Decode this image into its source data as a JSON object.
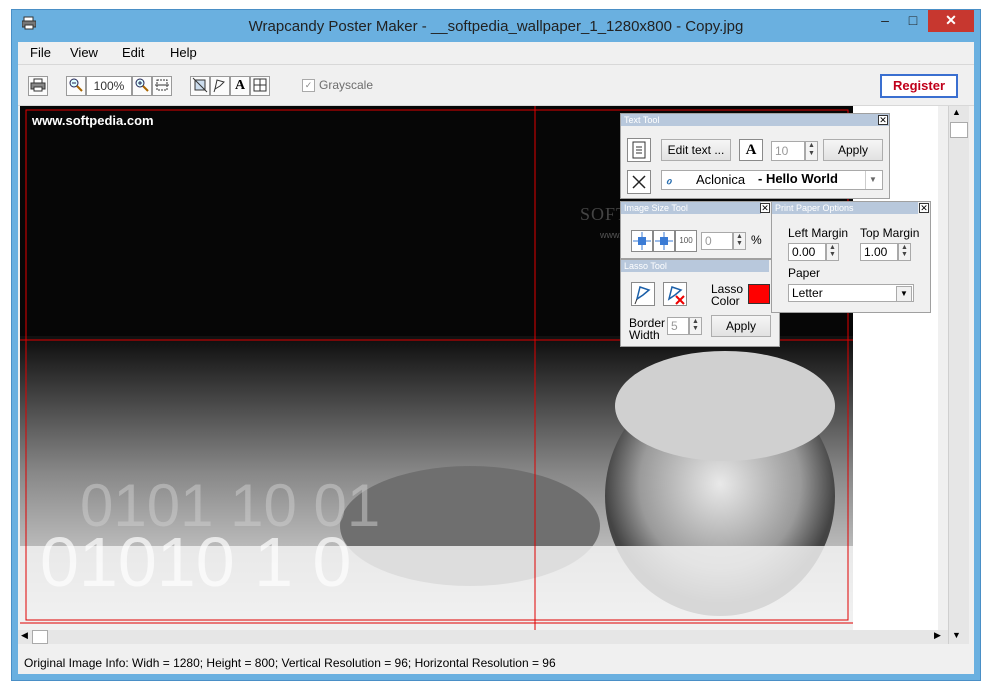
{
  "window": {
    "title": "Wrapcandy Poster Maker - __softpedia_wallpaper_1_1280x800 - Copy.jpg"
  },
  "menu": [
    "File",
    "View",
    "Edit",
    "Help"
  ],
  "toolbar": {
    "zoom": "100%",
    "grayscale_label": "Grayscale",
    "register_label": "Register"
  },
  "canvas": {
    "watermark_text": "www.softpedia.com",
    "center_text": "SOFTPEDIA",
    "center_sub": "www.softpedia.com"
  },
  "text_tool": {
    "title": "Text Tool",
    "edit_label": "Edit text ...",
    "font_size": "10",
    "apply_label": "Apply",
    "font_name": "Aclonica",
    "sample_text": "- Hello World"
  },
  "image_size_tool": {
    "title": "Image Size Tool",
    "percent_value": "0",
    "percent_sign": "%",
    "hundred": "100"
  },
  "lasso_tool": {
    "title": "Lasso Tool",
    "lasso_color_label_1": "Lasso",
    "lasso_color_label_2": "Color",
    "lasso_color": "#ff0000",
    "border_label_1": "Border",
    "border_label_2": "Width",
    "border_width": "5",
    "apply_label": "Apply"
  },
  "print_options": {
    "title": "Print Paper Options",
    "left_margin_label": "Left Margin",
    "left_margin": "0.00",
    "top_margin_label": "Top Margin",
    "top_margin": "1.00",
    "paper_label": "Paper",
    "paper_value": "Letter"
  },
  "status": {
    "text": "Original Image Info:    Widh = 1280; Height = 800; Vertical Resolution = 96; Horizontal Resolution = 96"
  },
  "colors": {
    "accent": "#c0001a",
    "grid_line": "#e00000",
    "title_bar": "#6ab0e0"
  }
}
